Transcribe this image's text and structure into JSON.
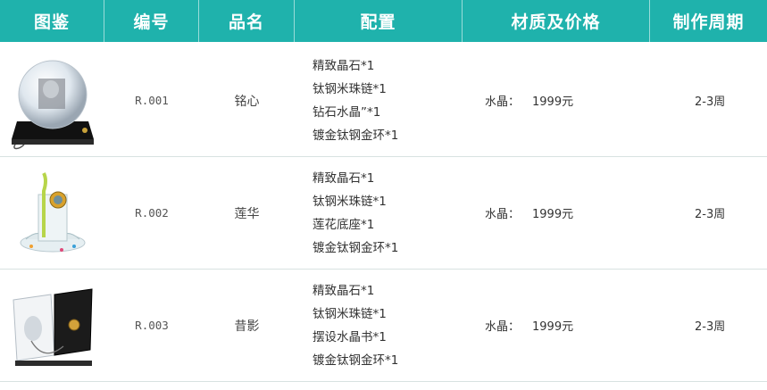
{
  "headers": [
    "图鉴",
    "编号",
    "品名",
    "配置",
    "材质及价格",
    "制作周期"
  ],
  "rows": [
    {
      "image": "crystal-ball-photo",
      "code": "R.001",
      "name": "铭心",
      "config": [
        "精致晶石*1",
        "钛钢米珠链*1",
        "钻石水晶”*1",
        "镀金钛钢金环*1"
      ],
      "material_label": "水晶：",
      "price": "1999元",
      "period": "2-3周"
    },
    {
      "image": "lotus-crystal-photo",
      "code": "R.002",
      "name": "莲华",
      "config": [
        "精致晶石*1",
        "钛钢米珠链*1",
        "莲花底座*1",
        "镀金钛钢金环*1"
      ],
      "material_label": "水晶：",
      "price": "1999元",
      "period": "2-3周"
    },
    {
      "image": "crystal-book-photo",
      "code": "R.003",
      "name": "昔影",
      "config": [
        "精致晶石*1",
        "钛钢米珠链*1",
        "摆设水晶书*1",
        "镀金钛钢金环*1"
      ],
      "material_label": "水晶：",
      "price": "1999元",
      "period": "2-3周"
    }
  ]
}
